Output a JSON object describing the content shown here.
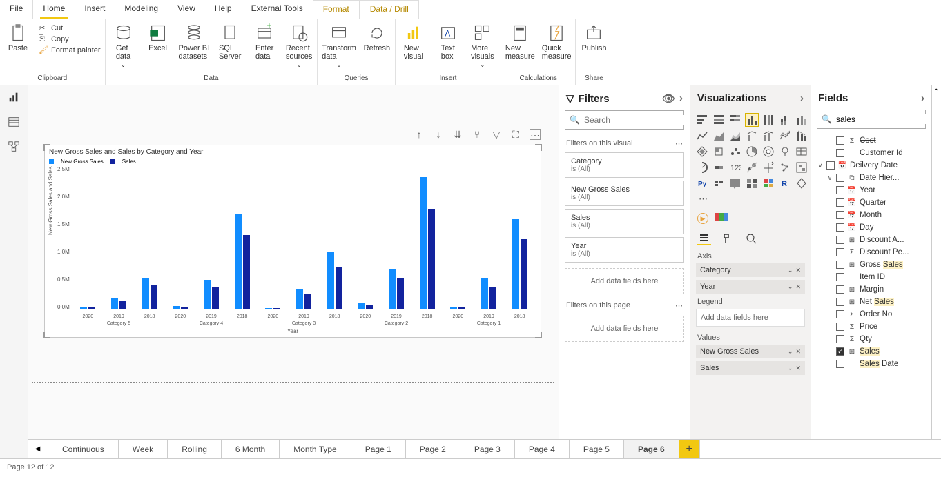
{
  "menu": {
    "file": "File",
    "home": "Home",
    "insert": "Insert",
    "modeling": "Modeling",
    "view": "View",
    "help": "Help",
    "external": "External Tools",
    "format": "Format",
    "datadrill": "Data / Drill"
  },
  "ribbon": {
    "clipboard": {
      "label": "Clipboard",
      "paste": "Paste",
      "cut": "Cut",
      "copy": "Copy",
      "fmt": "Format painter"
    },
    "data": {
      "label": "Data",
      "getdata": "Get\ndata",
      "excel": "Excel",
      "pbi": "Power BI\ndatasets",
      "sql": "SQL\nServer",
      "enter": "Enter\ndata",
      "recent": "Recent\nsources"
    },
    "queries": {
      "label": "Queries",
      "transform": "Transform\ndata",
      "refresh": "Refresh"
    },
    "insert": {
      "label": "Insert",
      "visual": "New\nvisual",
      "textbox": "Text\nbox",
      "more": "More\nvisuals"
    },
    "calc": {
      "label": "Calculations",
      "measure": "New\nmeasure",
      "quick": "Quick\nmeasure"
    },
    "share": {
      "label": "Share",
      "publish": "Publish"
    }
  },
  "chart_data": {
    "type": "bar",
    "title": "New Gross Sales and Sales by Category and Year",
    "legend": [
      "New Gross Sales",
      "Sales"
    ],
    "colors": [
      "#118DFF",
      "#12239E"
    ],
    "ylabel": "New Gross Sales and Sales",
    "xlabel": "Year",
    "yticks": [
      "0.0M",
      "0.5M",
      "1.0M",
      "1.5M",
      "2.0M",
      "2.5M"
    ],
    "ylim": [
      0,
      2600000
    ],
    "groups": [
      {
        "category": "Category 5",
        "years": [
          "2020",
          "2019",
          "2018"
        ],
        "series": [
          [
            50000,
            210000,
            600000
          ],
          [
            40000,
            160000,
            450000
          ]
        ]
      },
      {
        "category": "Category 4",
        "years": [
          "2020",
          "2019",
          "2018"
        ],
        "series": [
          [
            60000,
            560000,
            1800000
          ],
          [
            40000,
            420000,
            1400000
          ]
        ]
      },
      {
        "category": "Category 3",
        "years": [
          "2020",
          "2019",
          "2018"
        ],
        "series": [
          [
            30000,
            390000,
            1080000
          ],
          [
            20000,
            290000,
            810000
          ]
        ]
      },
      {
        "category": "Category 2",
        "years": [
          "2020",
          "2019",
          "2018"
        ],
        "series": [
          [
            120000,
            770000,
            2500000
          ],
          [
            90000,
            600000,
            1900000
          ]
        ]
      },
      {
        "category": "Category 1",
        "years": [
          "2020",
          "2019",
          "2018"
        ],
        "series": [
          [
            50000,
            580000,
            1700000
          ],
          [
            40000,
            420000,
            1320000
          ]
        ]
      }
    ]
  },
  "filters": {
    "title": "Filters",
    "search_ph": "Search",
    "visual_h": "Filters on this visual",
    "cards": [
      {
        "name": "Category",
        "val": "is (All)"
      },
      {
        "name": "New Gross Sales",
        "val": "is (All)"
      },
      {
        "name": "Sales",
        "val": "is (All)"
      },
      {
        "name": "Year",
        "val": "is (All)"
      }
    ],
    "add": "Add data fields here",
    "page_h": "Filters on this page"
  },
  "viz": {
    "title": "Visualizations",
    "wells": {
      "axis": "Axis",
      "axis_items": [
        "Category",
        "Year"
      ],
      "legend": "Legend",
      "legend_add": "Add data fields here",
      "values": "Values",
      "values_items": [
        "New Gross Sales",
        "Sales"
      ]
    }
  },
  "fields": {
    "title": "Fields",
    "search_val": "sales",
    "items": [
      {
        "lvl": 1,
        "cb": 0,
        "ic": "Σ",
        "txt": "Cost",
        "strike": 1
      },
      {
        "lvl": 1,
        "cb": 0,
        "ic": "",
        "txt": "Customer Id"
      },
      {
        "lvl": 0,
        "caret": "∨",
        "cb": 0,
        "ic": "📅",
        "txt": "Deilvery Date"
      },
      {
        "lvl": 1,
        "caret": "∨",
        "cb": 0,
        "ic": "⧉",
        "txt": "Date Hier..."
      },
      {
        "lvl": 2,
        "cb": 0,
        "ic": "📅",
        "txt": "Year"
      },
      {
        "lvl": 2,
        "cb": 0,
        "ic": "📅",
        "txt": "Quarter"
      },
      {
        "lvl": 2,
        "cb": 0,
        "ic": "📅",
        "txt": "Month"
      },
      {
        "lvl": 2,
        "cb": 0,
        "ic": "📅",
        "txt": "Day"
      },
      {
        "lvl": 1,
        "cb": 0,
        "ic": "⊞",
        "txt": "Discount A..."
      },
      {
        "lvl": 1,
        "cb": 0,
        "ic": "Σ",
        "txt": "Discount Pe..."
      },
      {
        "lvl": 1,
        "cb": 0,
        "ic": "⊞",
        "txt": "Gross ",
        "hl": "Sales"
      },
      {
        "lvl": 1,
        "cb": 0,
        "ic": "",
        "txt": "Item ID"
      },
      {
        "lvl": 1,
        "cb": 0,
        "ic": "⊞",
        "txt": "Margin"
      },
      {
        "lvl": 1,
        "cb": 0,
        "ic": "⊞",
        "txt": "Net ",
        "hl": "Sales"
      },
      {
        "lvl": 1,
        "cb": 0,
        "ic": "Σ",
        "txt": "Order No"
      },
      {
        "lvl": 1,
        "cb": 0,
        "ic": "Σ",
        "txt": "Price"
      },
      {
        "lvl": 1,
        "cb": 0,
        "ic": "Σ",
        "txt": "Qty"
      },
      {
        "lvl": 1,
        "cb": 1,
        "ic": "⊞",
        "txt": "",
        "hl": "Sales"
      },
      {
        "lvl": 1,
        "cb": 0,
        "ic": "",
        "txt": " Date",
        "hlpre": "Sales"
      }
    ]
  },
  "pages": {
    "tabs": [
      "Continuous",
      "Week",
      "Rolling",
      "6 Month",
      "Month Type",
      "Page 1",
      "Page 2",
      "Page 3",
      "Page 4",
      "Page 5",
      "Page 6"
    ],
    "active": 10
  },
  "status": "Page 12 of 12"
}
